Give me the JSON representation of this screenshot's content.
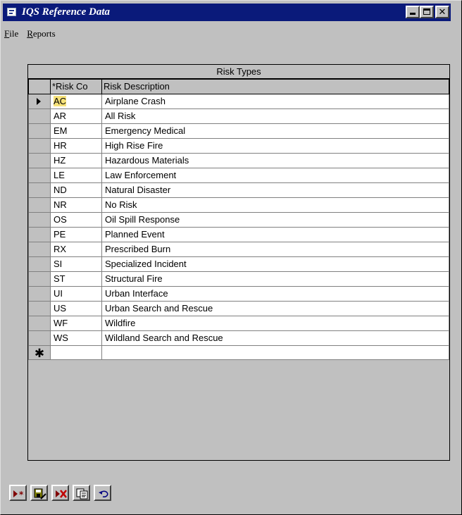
{
  "window": {
    "title": "IQS Reference Data",
    "buttons": [
      "minimize",
      "maximize",
      "close"
    ]
  },
  "menu": {
    "items": [
      {
        "label": "File",
        "mnemonic": "F"
      },
      {
        "label": "Reports",
        "mnemonic": "R"
      }
    ]
  },
  "grid": {
    "caption": "Risk Types",
    "columns": [
      "*Risk Co",
      "Risk Description"
    ],
    "current_row_index": 0,
    "highlight_color": "#f6e27a",
    "rows": [
      {
        "code": "AC",
        "description": "Airplane Crash"
      },
      {
        "code": "AR",
        "description": "All Risk"
      },
      {
        "code": "EM",
        "description": "Emergency Medical"
      },
      {
        "code": "HR",
        "description": "High Rise Fire"
      },
      {
        "code": "HZ",
        "description": "Hazardous Materials"
      },
      {
        "code": "LE",
        "description": "Law Enforcement"
      },
      {
        "code": "ND",
        "description": "Natural Disaster"
      },
      {
        "code": "NR",
        "description": "No Risk"
      },
      {
        "code": "OS",
        "description": "Oil Spill Response"
      },
      {
        "code": "PE",
        "description": "Planned Event"
      },
      {
        "code": "RX",
        "description": "Prescribed Burn"
      },
      {
        "code": "SI",
        "description": "Specialized Incident"
      },
      {
        "code": "ST",
        "description": "Structural Fire"
      },
      {
        "code": "UI",
        "description": "Urban Interface"
      },
      {
        "code": "US",
        "description": "Urban Search and Rescue"
      },
      {
        "code": "WF",
        "description": "Wildfire"
      },
      {
        "code": "WS",
        "description": "Wildland Search and Rescue"
      }
    ],
    "new_row_marker": "✱"
  },
  "toolbar": {
    "buttons": [
      {
        "name": "new-record-icon"
      },
      {
        "name": "save-record-icon"
      },
      {
        "name": "delete-record-icon"
      },
      {
        "name": "copy-record-icon"
      },
      {
        "name": "undo-icon"
      }
    ]
  }
}
